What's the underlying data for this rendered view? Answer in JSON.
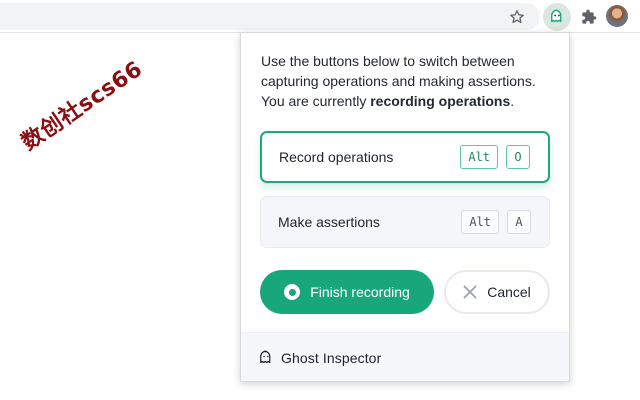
{
  "browser": {
    "icons": [
      "star-icon",
      "ghost-inspector-extension-icon",
      "extensions-puzzle-icon",
      "profile-avatar"
    ]
  },
  "watermark": {
    "text": "数创社scs66"
  },
  "popup": {
    "intro_prefix": "Use the buttons below to switch between capturing operations and making assertions. You are currently ",
    "intro_bold": "recording operations",
    "intro_suffix": ".",
    "modes": [
      {
        "label": "Record operations",
        "keys": [
          "Alt",
          "O"
        ],
        "active": true
      },
      {
        "label": "Make assertions",
        "keys": [
          "Alt",
          "A"
        ],
        "active": false
      }
    ],
    "finish_label": "Finish recording",
    "cancel_label": "Cancel",
    "brand": "Ghost Inspector"
  },
  "colors": {
    "accent": "#17a77b",
    "watermark": "#8b0f12",
    "footer_bg": "#f5f7fa"
  }
}
